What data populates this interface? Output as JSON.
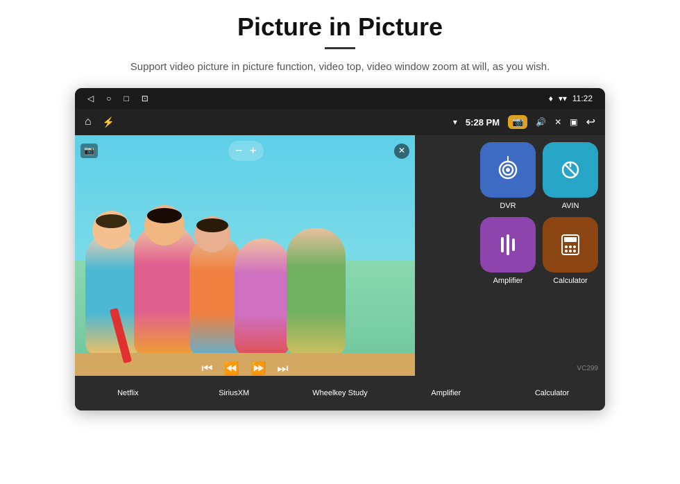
{
  "header": {
    "title": "Picture in Picture",
    "subtitle": "Support video picture in picture function, video top, video window zoom at will, as you wish."
  },
  "device": {
    "status_bar": {
      "back_icon": "◁",
      "circle_icon": "○",
      "square_icon": "□",
      "menu_icon": "⊡",
      "wifi_icon": "▾",
      "signal_icon": "▾",
      "time": "11:22"
    },
    "nav_bar": {
      "home_icon": "⌂",
      "usb_icon": "⚡",
      "wifi_strength": "▾",
      "time": "5:28 PM",
      "camera_icon": "📷",
      "volume_icon": "🔊",
      "close_icon": "✕",
      "pip_icon": "▣",
      "back_icon": "↩"
    },
    "pip": {
      "cam_icon": "📷",
      "minus_label": "−",
      "plus_label": "+",
      "close_label": "✕",
      "prev_label": "⏮",
      "rewind_label": "⏪",
      "forward_label": "⏩",
      "next_label": "⏭"
    },
    "apps_top": [
      {
        "label": "",
        "color": "#4CAF50",
        "icon": ""
      },
      {
        "label": "",
        "color": "#e91e8c",
        "icon": ""
      },
      {
        "label": "",
        "color": "#9c27b0",
        "icon": ""
      }
    ],
    "apps_bottom": [
      {
        "label": "Netflix",
        "color": "#e50914"
      },
      {
        "label": "SiriusXM",
        "color": "#0066cc"
      },
      {
        "label": "Wheelkey Study",
        "color": "#ff9800"
      },
      {
        "label": "Amplifier",
        "color": "#8e44ad"
      },
      {
        "label": "Calculator",
        "color": "#8B4513"
      }
    ],
    "apps_right": [
      {
        "row": [
          {
            "label": "DVR",
            "color": "#3d6bc4",
            "icon": "📡"
          },
          {
            "label": "AVIN",
            "color": "#26a5c6",
            "icon": "🔌"
          }
        ]
      },
      {
        "row": [
          {
            "label": "Amplifier",
            "color": "#8e44ad",
            "icon": "🎛"
          },
          {
            "label": "Calculator",
            "color": "#8B4513",
            "icon": "🧮"
          }
        ]
      }
    ],
    "watermark": "VC299"
  }
}
